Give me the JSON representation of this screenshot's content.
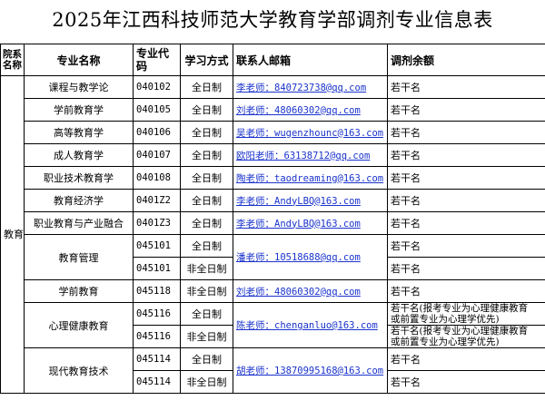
{
  "title": "2025年江西科技师范大学教育学部调剂专业信息表",
  "headers": {
    "dept": "院系名称",
    "major": "专业名称",
    "code": "专业代码",
    "mode": "学习方式",
    "contact": "联系人邮箱",
    "quota": "调剂余额"
  },
  "department": "教育学部",
  "rows": [
    {
      "major": "课程与教学论",
      "code": "040102",
      "mode": "全日制",
      "contact": "李老师：840723738@qq.com",
      "quota": "若干名"
    },
    {
      "major": "学前教育学",
      "code": "040105",
      "mode": "全日制",
      "contact": "刘老师：48060302@qq.com",
      "quota": "若干名"
    },
    {
      "major": "高等教育学",
      "code": "040106",
      "mode": "全日制",
      "contact": "吴老师：wugenzhounc@163.com",
      "quota": "若干名"
    },
    {
      "major": "成人教育学",
      "code": "040107",
      "mode": "全日制",
      "contact": "欧阳老师：63138712@qq.com",
      "quota": "若干名"
    },
    {
      "major": "职业技术教育学",
      "code": "040108",
      "mode": "全日制",
      "contact": "陶老师：taodreaming@163.com",
      "quota": "若干名"
    },
    {
      "major": "教育经济学",
      "code": "0401Z2",
      "mode": "全日制",
      "contact": "李老师：AndyLBQ@163.com",
      "quota": "若干名"
    },
    {
      "major": "职业教育与产业融合",
      "code": "0401Z3",
      "mode": "全日制",
      "contact": "李老师：AndyLBQ@163.com",
      "quota": "若干名"
    }
  ],
  "groups": {
    "jygl": {
      "major": "教育管理",
      "contact": "潘老师：10518688@qq.com",
      "rows": [
        {
          "code": "045101",
          "mode": "全日制",
          "quota": "若干名"
        },
        {
          "code": "045101",
          "mode": "非全日制",
          "quota": "若干名"
        }
      ]
    },
    "xqjy": {
      "major": "学前教育",
      "code": "045118",
      "mode": "非全日制",
      "contact": "刘老师：48060302@qq.com",
      "quota": "若干名"
    },
    "xljk": {
      "major": "心理健康教育",
      "contact": "陈老师：chenganluo@163.com",
      "rows": [
        {
          "code": "045116",
          "mode": "全日制",
          "quota_a": "若干名(报考专业为心理健康教育",
          "quota_b": "或前置专业为心理学优先)"
        },
        {
          "code": "045116",
          "mode": "非全日制",
          "quota_a": "若干名(报考专业为心理健康教育",
          "quota_b": "或前置专业为心理学优先)"
        }
      ]
    },
    "xdjs": {
      "major": "现代教育技术",
      "contact": "胡老师：13870995168@163.com",
      "rows": [
        {
          "code": "045114",
          "mode": "全日制",
          "quota": "若干名"
        },
        {
          "code": "045114",
          "mode": "非全日制",
          "quota": "若干名"
        }
      ]
    }
  }
}
